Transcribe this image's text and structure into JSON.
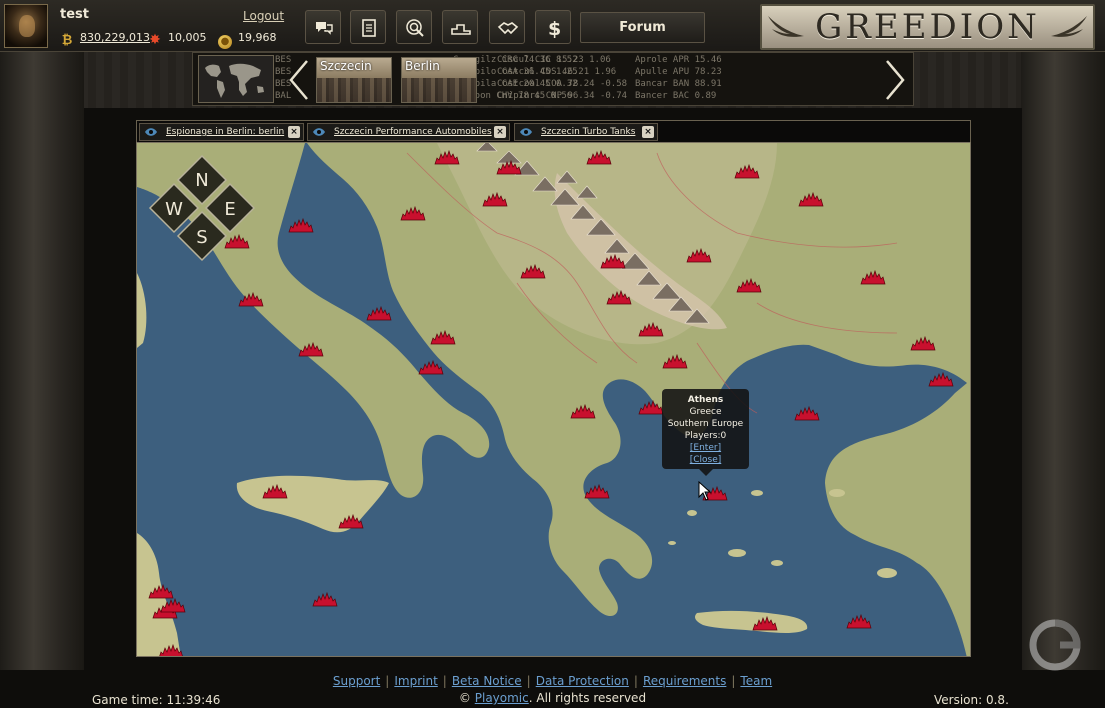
{
  "header": {
    "username": "test",
    "logout_label": "Logout",
    "money": "830,229,013",
    "reputation": "10,005",
    "gold": "19,968",
    "forum_label": "Forum",
    "logo": "GREEDION"
  },
  "strip": {
    "cities": [
      {
        "name": "Szczecin"
      },
      {
        "name": "Berlin"
      }
    ],
    "ticker": [
      [
        "BES",
        "Carrgilz  CRG 74.36 8.52",
        "Ciscul   CIC 15.23 1.06",
        "Aprole  APR 15.46"
      ],
      [
        "BES",
        "Catepilo  CAA 36.45 1.25",
        "Costcul  COS 46.21 1.96",
        "Apulle  APU 78.23"
      ],
      [
        "BES",
        "Catepila  CAE 20.45 0.32",
        "Costcoal COA 78.24 -0.58",
        "Bancar  BAN 88.91"
      ],
      [
        "BAL",
        "Chevoon   CHV 78.45 0.56",
        "Cnipinrs CNP 96.34 -0.74",
        "Bancer  BAC 0.89"
      ]
    ]
  },
  "tabs": [
    {
      "label": "Espionage in Berlin: berlin"
    },
    {
      "label": "Szczecin Performance Automobiles"
    },
    {
      "label": "Szczecin Turbo Tanks"
    }
  ],
  "map": {
    "compass": {
      "n": "N",
      "s": "S",
      "e": "E",
      "w": "W"
    },
    "tooltip": {
      "city": "Athens",
      "country": "Greece",
      "region": "Southern Europe",
      "players": "Players:0",
      "enter": "[Enter]",
      "close": "[Close]"
    }
  },
  "footer": {
    "links": [
      "Support",
      "Imprint",
      "Beta Notice",
      "Data Protection",
      "Requirements",
      "Team"
    ],
    "copyright_prefix": "©",
    "company": "Playomic",
    "copyright_suffix": ". All rights reserved",
    "game_time": "Game time: 11:39:46",
    "version": "Version: 0.8."
  },
  "colors": {
    "sea": "#3d5f7e",
    "land": "#a8ad78",
    "city_marker": "#c8102e",
    "link": "#6b9fd0"
  }
}
